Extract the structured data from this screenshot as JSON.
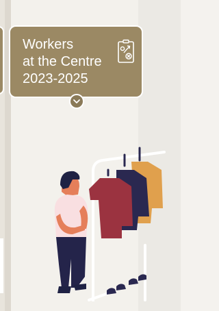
{
  "card": {
    "title_lines": [
      "Workers",
      "at the Centre",
      "2023-2025"
    ],
    "icon": "strategy-board-icon",
    "expand_icon": "chevron-down-icon"
  },
  "illustration": {
    "subject": "person-browsing-clothing-rack",
    "colors": {
      "shirt_red": "#9b3340",
      "shirt_navy": "#2a2850",
      "shirt_orange": "#e0a04d",
      "person_shirt": "#f9dfe1",
      "person_pants": "#24244a",
      "skin": "#e57f5a",
      "hair": "#1f2244"
    }
  },
  "colors": {
    "card_bg": "#9b8964",
    "card_border": "#ffffff",
    "page_bg": "#f3f1ec"
  }
}
